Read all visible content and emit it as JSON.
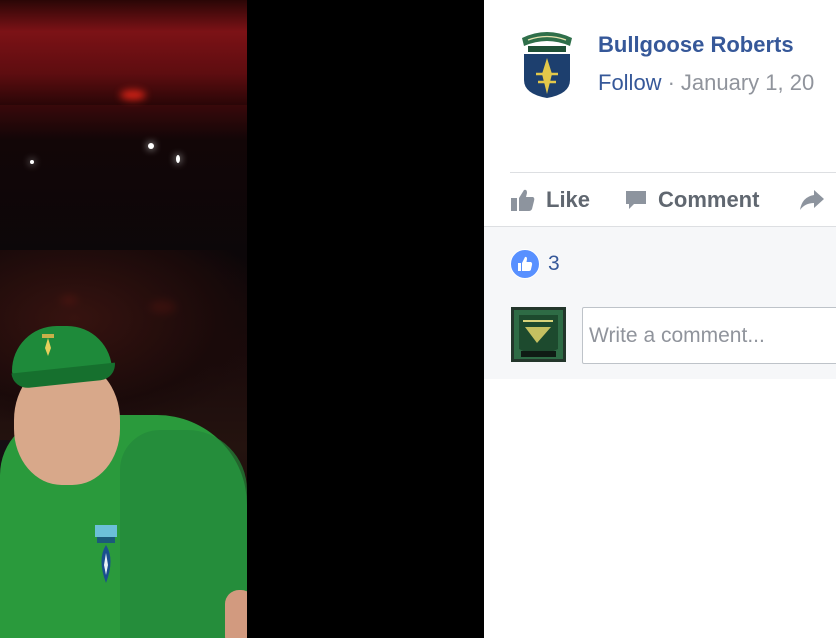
{
  "post": {
    "author_name": "Bullgoose Roberts",
    "follow_label": "Follow",
    "separator": "·",
    "date": "January 1, 20"
  },
  "actions": {
    "like_label": "Like",
    "comment_label": "Comment"
  },
  "reactions": {
    "count": "3"
  },
  "composer": {
    "placeholder": "Write a comment..."
  },
  "icons": {
    "like": "thumbs-up-icon",
    "comment": "speech-bubble-icon",
    "share": "share-arrow-icon"
  },
  "colors": {
    "link_blue": "#365899",
    "meta_gray": "#90949c",
    "action_gray": "#606770",
    "like_badge": "#5890ff"
  }
}
